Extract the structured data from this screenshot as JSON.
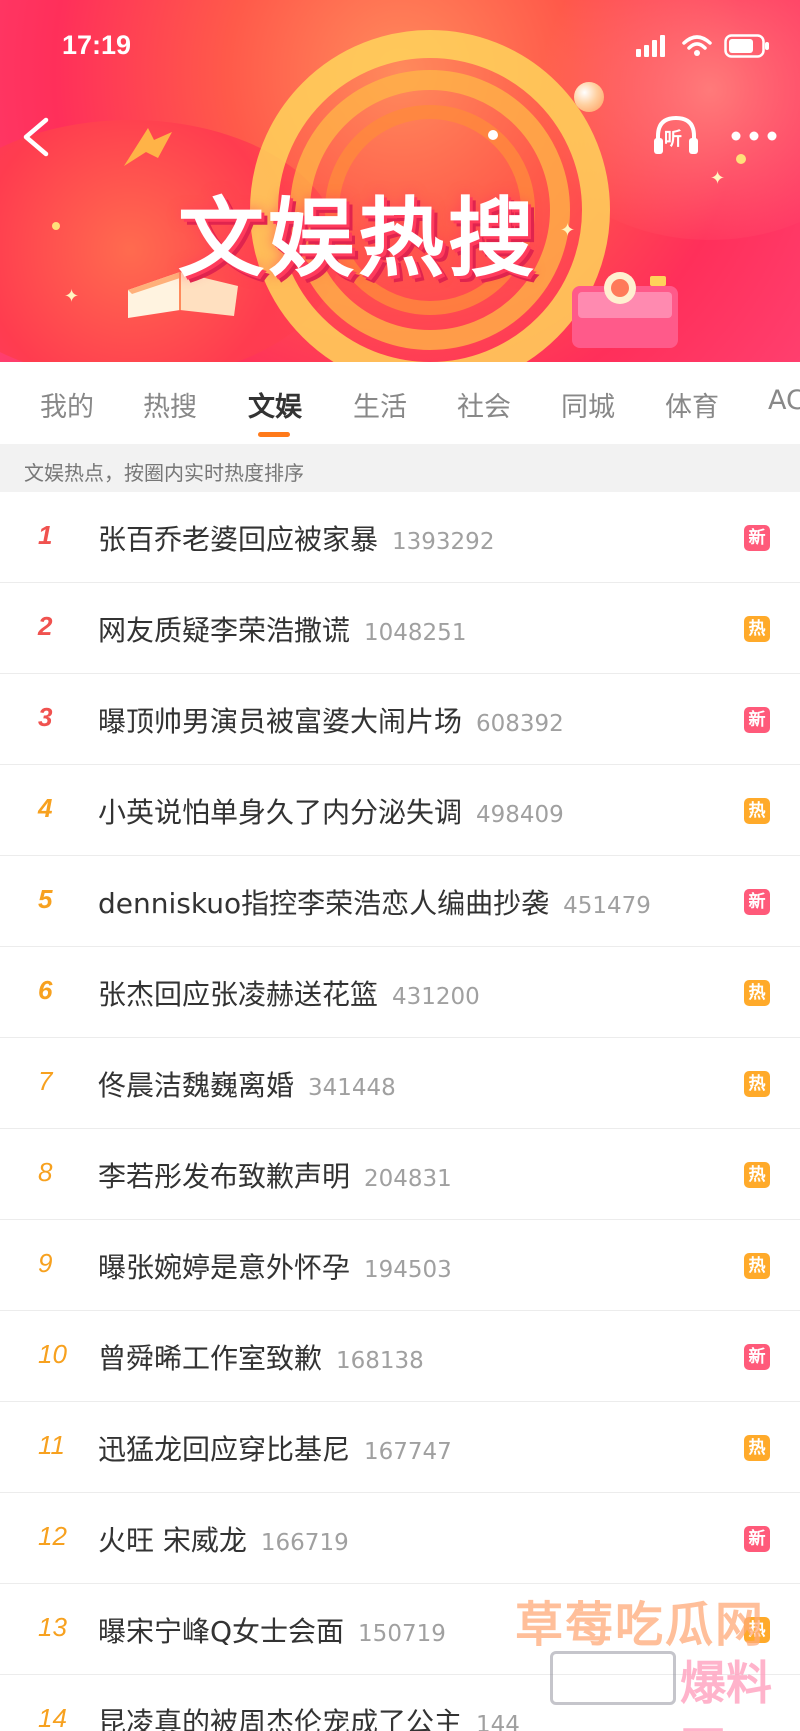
{
  "status_bar": {
    "time": "17:19"
  },
  "header": {
    "title": "文娱热搜",
    "listen_label": "听",
    "colors": {
      "primary": "#ff3f5a",
      "accent": "#ff7a1a"
    }
  },
  "tabs": [
    {
      "label": "我的",
      "active": false
    },
    {
      "label": "热搜",
      "active": false
    },
    {
      "label": "文娱",
      "active": true
    },
    {
      "label": "生活",
      "active": false
    },
    {
      "label": "社会",
      "active": false
    },
    {
      "label": "同城",
      "active": false
    },
    {
      "label": "体育",
      "active": false
    },
    {
      "label": "AC",
      "active": false
    }
  ],
  "subheader": {
    "text": "文娱热点，按圈内实时热度排序"
  },
  "items": [
    {
      "rank": "1",
      "title": "张百乔老婆回应被家暴",
      "count": "1393292",
      "badge": "新",
      "badge_type": "new"
    },
    {
      "rank": "2",
      "title": "网友质疑李荣浩撒谎",
      "count": "1048251",
      "badge": "热",
      "badge_type": "hot"
    },
    {
      "rank": "3",
      "title": "曝顶帅男演员被富婆大闹片场",
      "count": "608392",
      "badge": "新",
      "badge_type": "new"
    },
    {
      "rank": "4",
      "title": "小英说怕单身久了内分泌失调",
      "count": "498409",
      "badge": "热",
      "badge_type": "hot"
    },
    {
      "rank": "5",
      "title": "denniskuo指控李荣浩恋人编曲抄袭",
      "count": "451479",
      "badge": "新",
      "badge_type": "new"
    },
    {
      "rank": "6",
      "title": "张杰回应张凌赫送花篮",
      "count": "431200",
      "badge": "热",
      "badge_type": "hot"
    },
    {
      "rank": "7",
      "title": "佟晨洁魏巍离婚",
      "count": "341448",
      "badge": "热",
      "badge_type": "hot"
    },
    {
      "rank": "8",
      "title": "李若彤发布致歉声明",
      "count": "204831",
      "badge": "热",
      "badge_type": "hot"
    },
    {
      "rank": "9",
      "title": "曝张婉婷是意外怀孕",
      "count": "194503",
      "badge": "热",
      "badge_type": "hot"
    },
    {
      "rank": "10",
      "title": "曾舜晞工作室致歉",
      "count": "168138",
      "badge": "新",
      "badge_type": "new"
    },
    {
      "rank": "11",
      "title": "迅猛龙回应穿比基尼",
      "count": "167747",
      "badge": "热",
      "badge_type": "hot"
    },
    {
      "rank": "12",
      "title": "火旺 宋威龙",
      "count": "166719",
      "badge": "新",
      "badge_type": "new"
    },
    {
      "rank": "13",
      "title": "曝宋宁峰Q女士会面",
      "count": "150719",
      "badge": "热",
      "badge_type": "hot"
    },
    {
      "rank": "14",
      "title": "昆凌真的被周杰伦宠成了公主",
      "count": "144",
      "badge": "",
      "badge_type": "none"
    }
  ],
  "watermark": {
    "top": "草莓吃瓜网",
    "bottom": "爆料网"
  }
}
